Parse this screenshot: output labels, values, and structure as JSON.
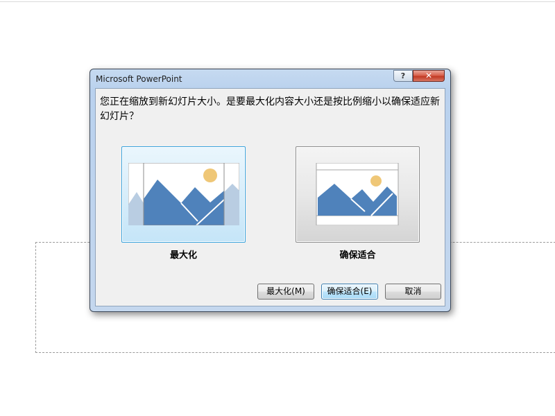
{
  "dialog": {
    "title": "Microsoft PowerPoint",
    "help_label": "?",
    "close_label": "✕",
    "message": "您正在缩放到新幻灯片大小。是要最大化内容大小还是按比例缩小以确保适应新幻灯片？",
    "options": [
      {
        "label": "最大化",
        "selected": true
      },
      {
        "label": "确保适合",
        "selected": false
      }
    ],
    "buttons": {
      "maximize": "最大化(M)",
      "ensure_fit": "确保适合(E)",
      "cancel": "取消"
    }
  },
  "colors": {
    "mountain": "#4f82bb",
    "mountain_faded": "#b9cde2",
    "sun": "#efc777",
    "selection_border": "#39a3dd"
  }
}
